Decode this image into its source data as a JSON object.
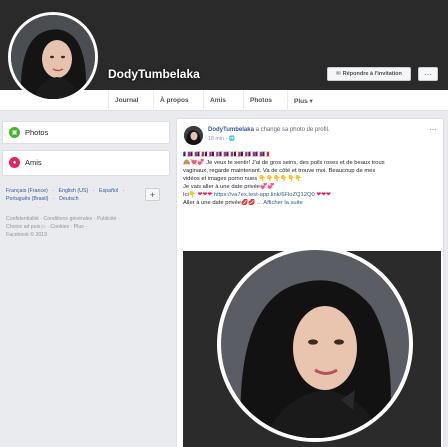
{
  "profile": {
    "name": "DodyTumbelaka"
  },
  "header": {
    "reply_button": "Répondre à l'invitation",
    "more_button": "···"
  },
  "nav": {
    "tabs": [
      "Journal",
      "À propos",
      "Amis",
      "Photos",
      "Plus ▾"
    ]
  },
  "sidebar": {
    "photos_label": "Photos",
    "friends_label": "Amis"
  },
  "languages": {
    "line1": [
      "Français (France)",
      "·",
      "English (US)",
      "·",
      "Español",
      "·"
    ],
    "line2": [
      "Português (Brasil)",
      "·",
      "Deutsch"
    ],
    "add": "+"
  },
  "footer": {
    "line1": "Confidentialité · Conditions générales · Publicité ·",
    "line2": "Choice ad puis ▷ · Cookies · Plus ·",
    "copyright": "Facebook © 2019"
  },
  "post": {
    "author": "DodyTumbelaka",
    "action": " a changé sa photo de profil.",
    "time": "18 min · ",
    "menu": "···",
    "line1": "🇫🇷🇫🇷🇫🇷🇫🇷🇫🇷🇫🇷🇫🇷🇫🇷🇫🇷🇫🇷🇫🇷🇫🇷",
    "line2": " Je veux te sentir! J'ai de gros seins, des poils roses et de beaux trous",
    "line2_prefix": "🙈💘💞",
    "line3": "vaginaux, regarde maintenant. Va de côté et trouve moi. Beaucoup de mes",
    "line4": "vidéos et images porno nues",
    "line4_emoji": "👇👇👇👇👇👇",
    "line5": "Je vais aller à une date privée",
    "line5_emoji": "💞💞",
    "line6_prefix": "Ici",
    "line6_mid": "👇",
    "line6_hearts": "❤❤❤",
    "line6_link": "https://va7ex.test-app.link/6FloZQ12Q0",
    "line6_tail": "❤❤❤",
    "line7": "Aller à une date privée",
    "line7_emoji": "💋💋",
    "see_more": "... Afficher la suite"
  },
  "colors": {
    "facebook_blue": "#365899",
    "background": "#e9ebee",
    "photos_icon": "#42b72a",
    "friends_icon": "#e0245e"
  }
}
